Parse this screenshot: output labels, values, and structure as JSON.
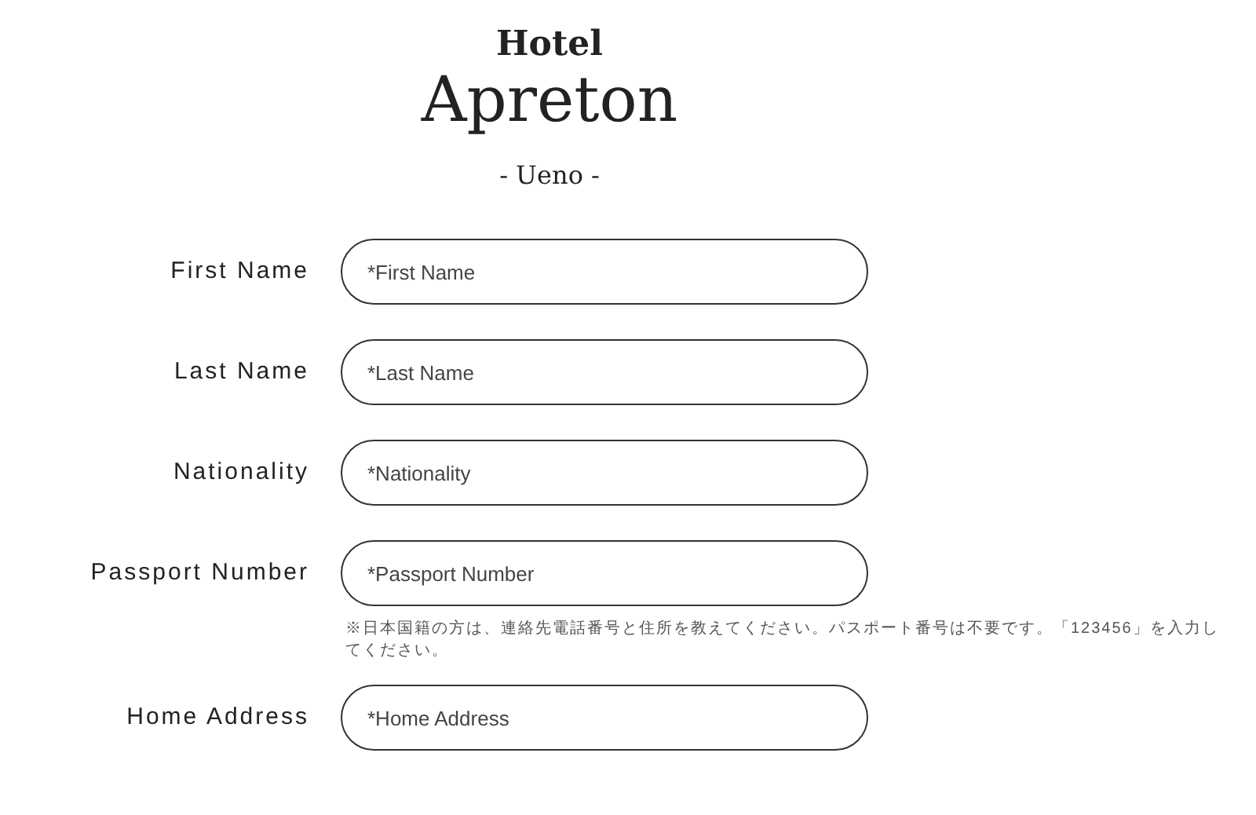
{
  "logo": {
    "line_1": "Hotel",
    "line_2": "Apreton",
    "line_3": "- Ueno -"
  },
  "fields": [
    {
      "label": "First Name",
      "placeholder": "*First Name"
    },
    {
      "label": "Last Name",
      "placeholder": "*Last Name"
    },
    {
      "label": "Nationality",
      "placeholder": "*Nationality"
    },
    {
      "label": "Passport Number",
      "placeholder": "*Passport Number",
      "note": "※日本国籍の方は、連絡先電話番号と住所を教えてください。パスポート番号は不要です。「123456」を入力してください。"
    },
    {
      "label": "Home Address",
      "placeholder": "*Home Address"
    }
  ]
}
